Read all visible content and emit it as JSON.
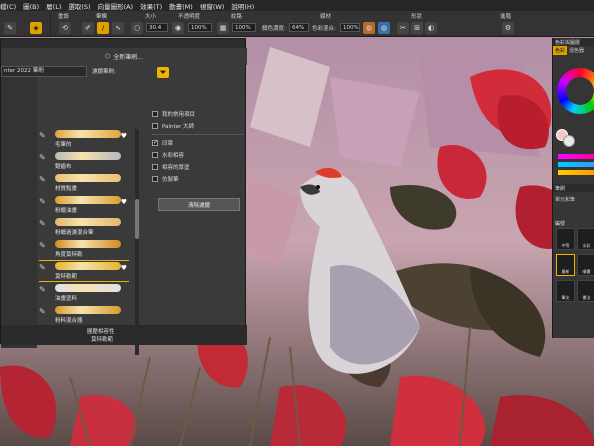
{
  "menubar": {
    "items": [
      "檔(C)",
      "圖(B)",
      "層(L)",
      "選取(S)",
      "向量圖形(A)",
      "效果(T)",
      "動畫(M)",
      "視窗(W)",
      "說明(H)"
    ]
  },
  "propbar": {
    "groups": {
      "reset": "重設",
      "stroke": "筆觸",
      "size": "大小",
      "opacity": "不透明度",
      "grain": "紋路",
      "media": "媒材",
      "shape": "形狀",
      "advanced": "進階"
    },
    "size_value": "30.4",
    "opacity_value": "100%",
    "grain_value": "100%",
    "resat_label": "顏色濃度:",
    "resat_value": "64%",
    "bleed_label": "色彩混合:",
    "bleed_value": "100%"
  },
  "brush_panel": {
    "new_label": "全新筆刷...",
    "library_value": "nter 2022 筆刷",
    "filter_label": "濾鏡筆刷:",
    "filters": [
      {
        "label": "我的常用項目",
        "checked": false
      },
      {
        "label": "Painter 大師",
        "checked": false
      },
      {
        "label": "印章",
        "checked": true
      },
      {
        "label": "水彩相容",
        "checked": false
      },
      {
        "label": "相容的厚塗",
        "checked": false
      },
      {
        "label": "仿製筆",
        "checked": false
      }
    ],
    "clear_label": "清除濾鏡",
    "brushes": [
      {
        "name": "毛筆的",
        "fav": true,
        "icon": "brush-icon",
        "color": "#e0a43c"
      },
      {
        "name": "鋸齒布",
        "fav": false,
        "icon": "comb-icon",
        "color": "#b8b8b8"
      },
      {
        "name": "材質點畫",
        "fav": false,
        "icon": "dots-icon",
        "color": "#e8c070"
      },
      {
        "name": "粉蠟油畫",
        "fav": true,
        "icon": "crayon-icon",
        "color": "#d9a030"
      },
      {
        "name": "粉蠟過濾混合筆",
        "fav": false,
        "icon": "crayon-icon",
        "color": "#e2b66a"
      },
      {
        "name": "角度莫特勒",
        "fav": false,
        "icon": "splatter-icon",
        "color": "#d08a20"
      },
      {
        "name": "莫特勒範",
        "fav": true,
        "icon": "splatter-icon",
        "color": "#e8b030",
        "selected": true
      },
      {
        "name": "油畫塗料",
        "fav": false,
        "icon": "tube-icon",
        "color": "#e0e0e0"
      },
      {
        "name": "粉料混合器",
        "fav": false,
        "icon": "brush-icon",
        "color": "#d89a28"
      }
    ],
    "footer_label1": "圓壓相容性",
    "footer_label2": "莫特勒範"
  },
  "right_panel": {
    "title": "色彩與圖層",
    "tabs": [
      "色彩",
      "混色器"
    ],
    "prop_title": "筆刷",
    "subs": "單元和筆",
    "brushes_title": "編號",
    "tiles": [
      {
        "label": "中等",
        "selected": false
      },
      {
        "label": "水彩",
        "selected": false
      },
      {
        "label": "最新",
        "selected": true
      },
      {
        "label": "噴畫",
        "selected": false
      },
      {
        "label": "筆尖",
        "selected": false
      },
      {
        "label": "書法",
        "selected": false
      }
    ]
  },
  "colors": {
    "accent": "#f0b400",
    "panel_bg": "#3a3a3a"
  }
}
